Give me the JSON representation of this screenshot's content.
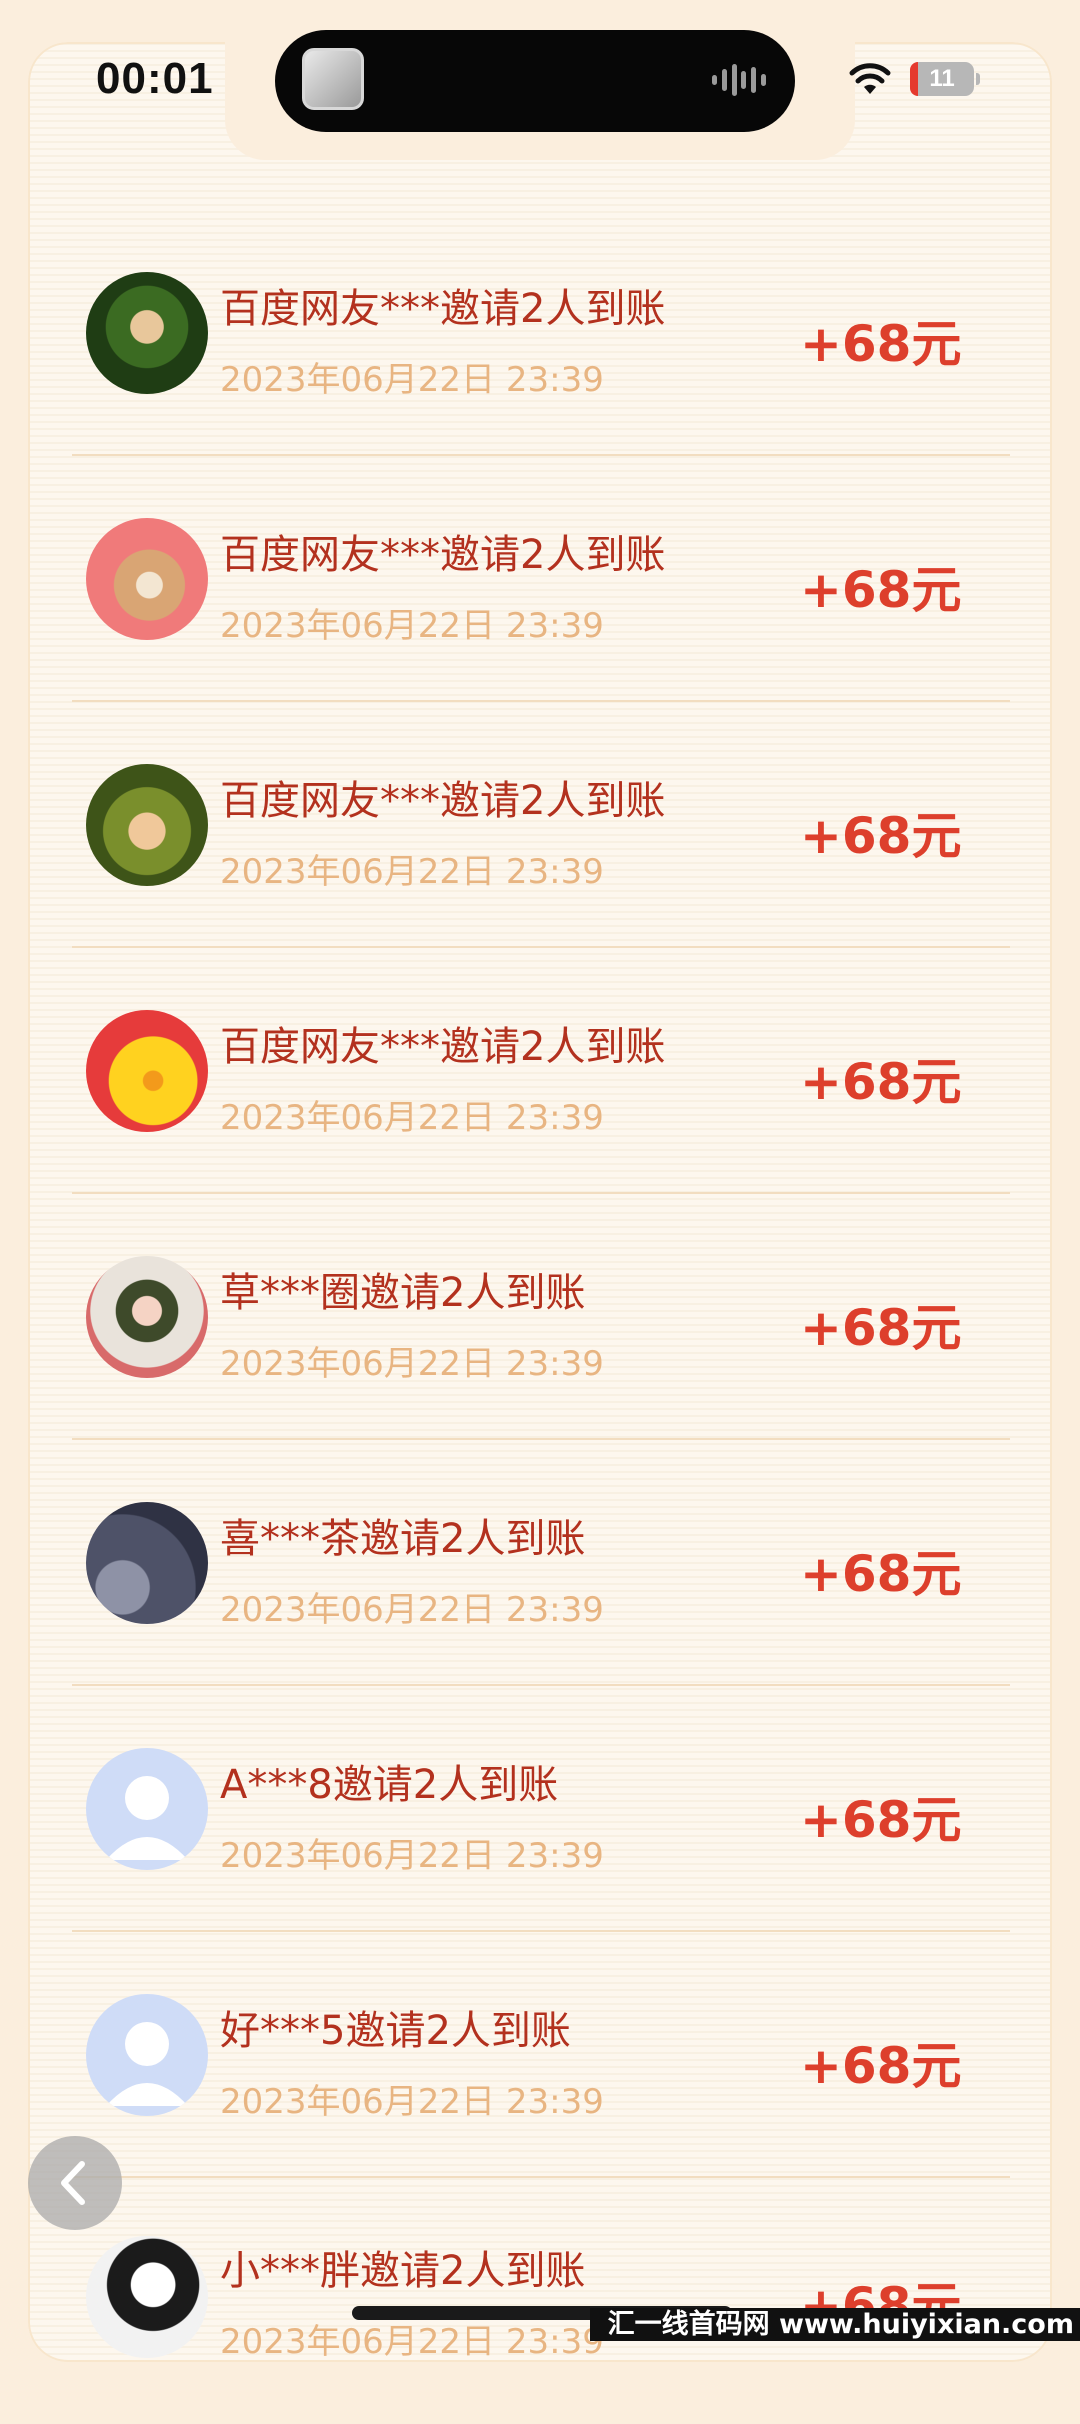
{
  "status_bar": {
    "time": "00:01",
    "battery": "11"
  },
  "records": [
    {
      "title": "百度网友***邀请2人到账",
      "time": "2023年06月22日 23:39",
      "amount": "+68元",
      "avatar": "elf-woman-green-avatar"
    },
    {
      "title": "百度网友***邀请2人到账",
      "time": "2023年06月22日 23:39",
      "amount": "+68元",
      "avatar": "cartoon-bear-avatar"
    },
    {
      "title": "百度网友***邀请2人到账",
      "time": "2023年06月22日 23:39",
      "amount": "+68元",
      "avatar": "elf-boy-winking-avatar"
    },
    {
      "title": "百度网友***邀请2人到账",
      "time": "2023年06月22日 23:39",
      "amount": "+68元",
      "avatar": "yellow-duck-avatar"
    },
    {
      "title": "草***圈邀请2人到账",
      "time": "2023年06月22日 23:39",
      "amount": "+68元",
      "avatar": "boy-flower-crown-avatar"
    },
    {
      "title": "喜***茶邀请2人到账",
      "time": "2023年06月22日 23:39",
      "amount": "+68元",
      "avatar": "sleeping-figure-avatar"
    },
    {
      "title": "A***8邀请2人到账",
      "time": "2023年06月22日 23:39",
      "amount": "+68元",
      "avatar": "default-user-avatar"
    },
    {
      "title": "好***5邀请2人到账",
      "time": "2023年06月22日 23:39",
      "amount": "+68元",
      "avatar": "default-user-avatar"
    },
    {
      "title": "小***胖邀请2人到账",
      "time": "2023年06月22日 23:39",
      "amount": "+68元",
      "avatar": "sketch-person-avatar"
    }
  ],
  "watermark": "汇一线首码网 www.huiyixian.com",
  "colors": {
    "title": "#b3311e",
    "time": "#e8b582",
    "amount": "#dd3f2c",
    "background": "#fdf7ee"
  }
}
